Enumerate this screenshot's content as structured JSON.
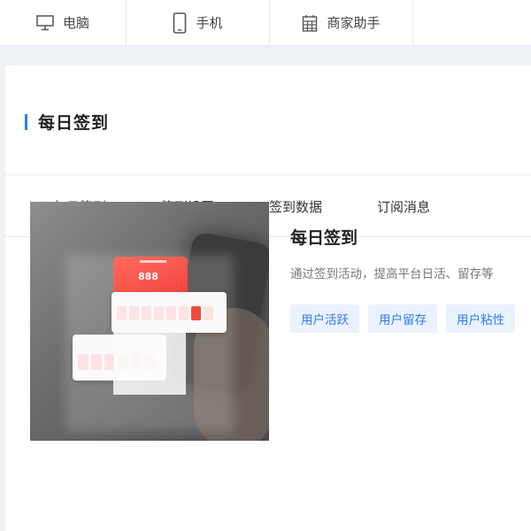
{
  "device_tabs": [
    {
      "label": "电脑",
      "icon": "desktop-icon"
    },
    {
      "label": "手机",
      "icon": "mobile-icon"
    },
    {
      "label": "商家助手",
      "icon": "building-icon"
    }
  ],
  "page": {
    "title": "每日签到",
    "accent_color": "#2f7cf6"
  },
  "sub_tabs": [
    {
      "label": "每日签到",
      "active": true
    },
    {
      "label": "签到设置",
      "active": false
    },
    {
      "label": "签到数据",
      "active": false
    },
    {
      "label": "订阅消息",
      "active": false
    }
  ],
  "feature": {
    "title": "每日签到",
    "description": "通过签到活动，提高平台日活、留存等",
    "mock_number": "888",
    "tags": [
      "用户活跃",
      "用户留存",
      "用户粘性"
    ]
  }
}
